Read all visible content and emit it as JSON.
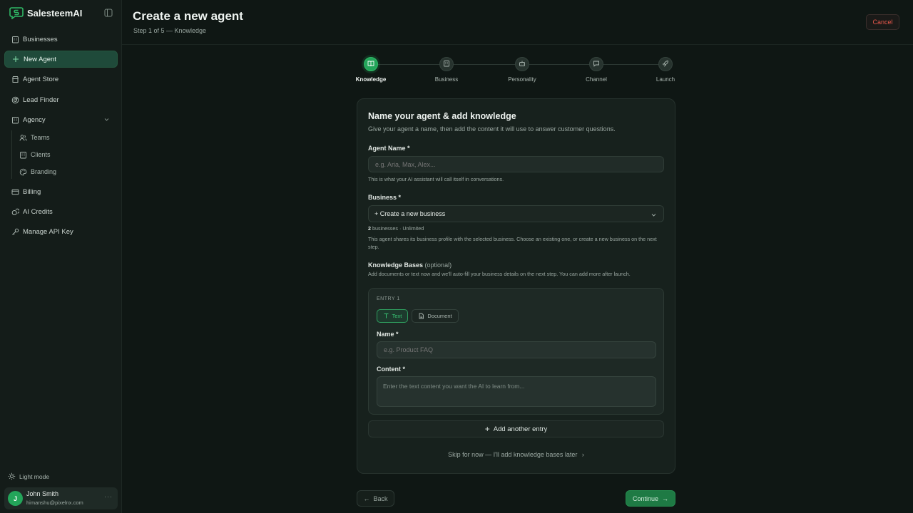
{
  "app": {
    "name": "SalesteemAI"
  },
  "sidebar": {
    "items": [
      {
        "label": "Businesses",
        "icon": "building-icon"
      },
      {
        "label": "New Agent",
        "icon": "plus-icon",
        "active": true
      },
      {
        "label": "Agent Store",
        "icon": "store-icon"
      },
      {
        "label": "Lead Finder",
        "icon": "radar-icon"
      },
      {
        "label": "Agency",
        "icon": "building-icon",
        "expanded": true
      },
      {
        "label": "Billing",
        "icon": "card-icon"
      },
      {
        "label": "AI Credits",
        "icon": "coins-icon"
      },
      {
        "label": "Manage API Key",
        "icon": "key-icon"
      }
    ],
    "agency_sub": [
      {
        "label": "Teams",
        "icon": "users-icon"
      },
      {
        "label": "Clients",
        "icon": "building-icon"
      },
      {
        "label": "Branding",
        "icon": "palette-icon"
      }
    ],
    "light_mode_label": "Light mode",
    "user": {
      "initial": "J",
      "name": "John Smith",
      "email": "himanshu@pixelnx.com"
    }
  },
  "header": {
    "title": "Create a new agent",
    "subtitle": "Step 1 of 5 — Knowledge",
    "cancel_label": "Cancel"
  },
  "stepper": {
    "current": 0,
    "steps": [
      {
        "label": "Knowledge",
        "icon": "book-icon"
      },
      {
        "label": "Business",
        "icon": "building-icon"
      },
      {
        "label": "Personality",
        "icon": "bot-icon"
      },
      {
        "label": "Channel",
        "icon": "message-icon"
      },
      {
        "label": "Launch",
        "icon": "rocket-icon"
      }
    ]
  },
  "form": {
    "title": "Name your agent & add knowledge",
    "description": "Give your agent a name, then add the content it will use to answer customer questions.",
    "agent_name": {
      "label": "Agent Name *",
      "placeholder": "e.g. Aria, Max, Alex...",
      "hint": "This is what your AI assistant will call itself in conversations."
    },
    "business": {
      "label": "Business *",
      "selected": "+ Create a new business",
      "count": "2",
      "count_suffix": " businesses · Unlimited",
      "hint": "This agent shares its business profile with the selected business. Choose an existing one, or create a new business on the next step."
    },
    "knowledge": {
      "label": "Knowledge Bases",
      "optional": "(optional)",
      "hint": "Add documents or text now and we'll auto-fill your business details on the next step. You can add more after launch.",
      "entry": {
        "tag": "ENTRY 1",
        "type_text": "Text",
        "type_document": "Document",
        "name_label": "Name *",
        "name_placeholder": "e.g. Product FAQ",
        "content_label": "Content *",
        "content_placeholder": "Enter the text content you want the AI to learn from..."
      },
      "add_entry_label": "Add another entry",
      "skip_label": "Skip for now — I'll add knowledge bases later"
    }
  },
  "footer": {
    "back_label": "Back",
    "continue_label": "Continue"
  },
  "colors": {
    "accent": "#23a55a",
    "danger": "#e5574b",
    "background": "#0f1714"
  }
}
